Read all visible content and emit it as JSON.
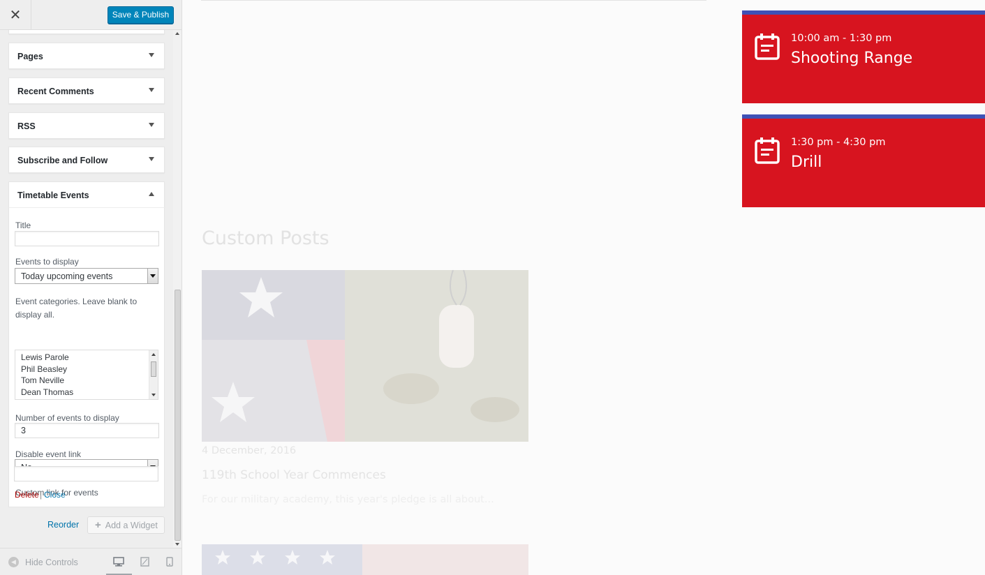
{
  "topbar": {
    "close_glyph": "✕",
    "publish_label": "Save & Publish"
  },
  "widgets": [
    {
      "title": "Pages"
    },
    {
      "title": "Recent Comments"
    },
    {
      "title": "RSS"
    },
    {
      "title": "Subscribe and Follow"
    },
    {
      "title": "Timetable Events"
    }
  ],
  "form": {
    "title_label": "Title",
    "title_value": "",
    "events_label": "Events to display",
    "events_value": "Today upcoming events",
    "categories_label": "Event categories. Leave blank to display all.",
    "categories": [
      "Lewis Parole",
      "Phil Beasley",
      "Tom Neville",
      "Dean Thomas"
    ],
    "number_label": "Number of events to display",
    "number_value": "3",
    "disable_label": "Disable event link",
    "disable_value": "No",
    "custom_link_label": "Custom link for events",
    "custom_link_value": "",
    "delete_label": "Delete",
    "separator": "|",
    "close_label": "Close"
  },
  "actions": {
    "reorder_label": "Reorder",
    "add_widget_label": "Add a Widget"
  },
  "footer": {
    "hide_label": "Hide Controls"
  },
  "preview": {
    "events": [
      {
        "time": "10:00 am - 1:30 pm",
        "name": "Shooting Range"
      },
      {
        "time": "1:30 pm - 4:30 pm",
        "name": "Drill"
      }
    ],
    "section_title": "Custom Posts",
    "post": {
      "date": "4 December, 2016",
      "title": "119th School Year Commences",
      "excerpt": "For our military academy, this year's pledge is all about..."
    }
  },
  "colors": {
    "event_bg": "#d7141f",
    "event_stripe": "#3f51b5",
    "publish": "#0085ba",
    "link_delete": "#a00",
    "link": "#0073aa"
  },
  "icons": [
    "close-icon",
    "chevron-down-icon",
    "chevron-up-icon",
    "plus-icon",
    "calendar-icon",
    "hide-controls-icon",
    "desktop-icon",
    "tablet-icon",
    "mobile-icon"
  ]
}
